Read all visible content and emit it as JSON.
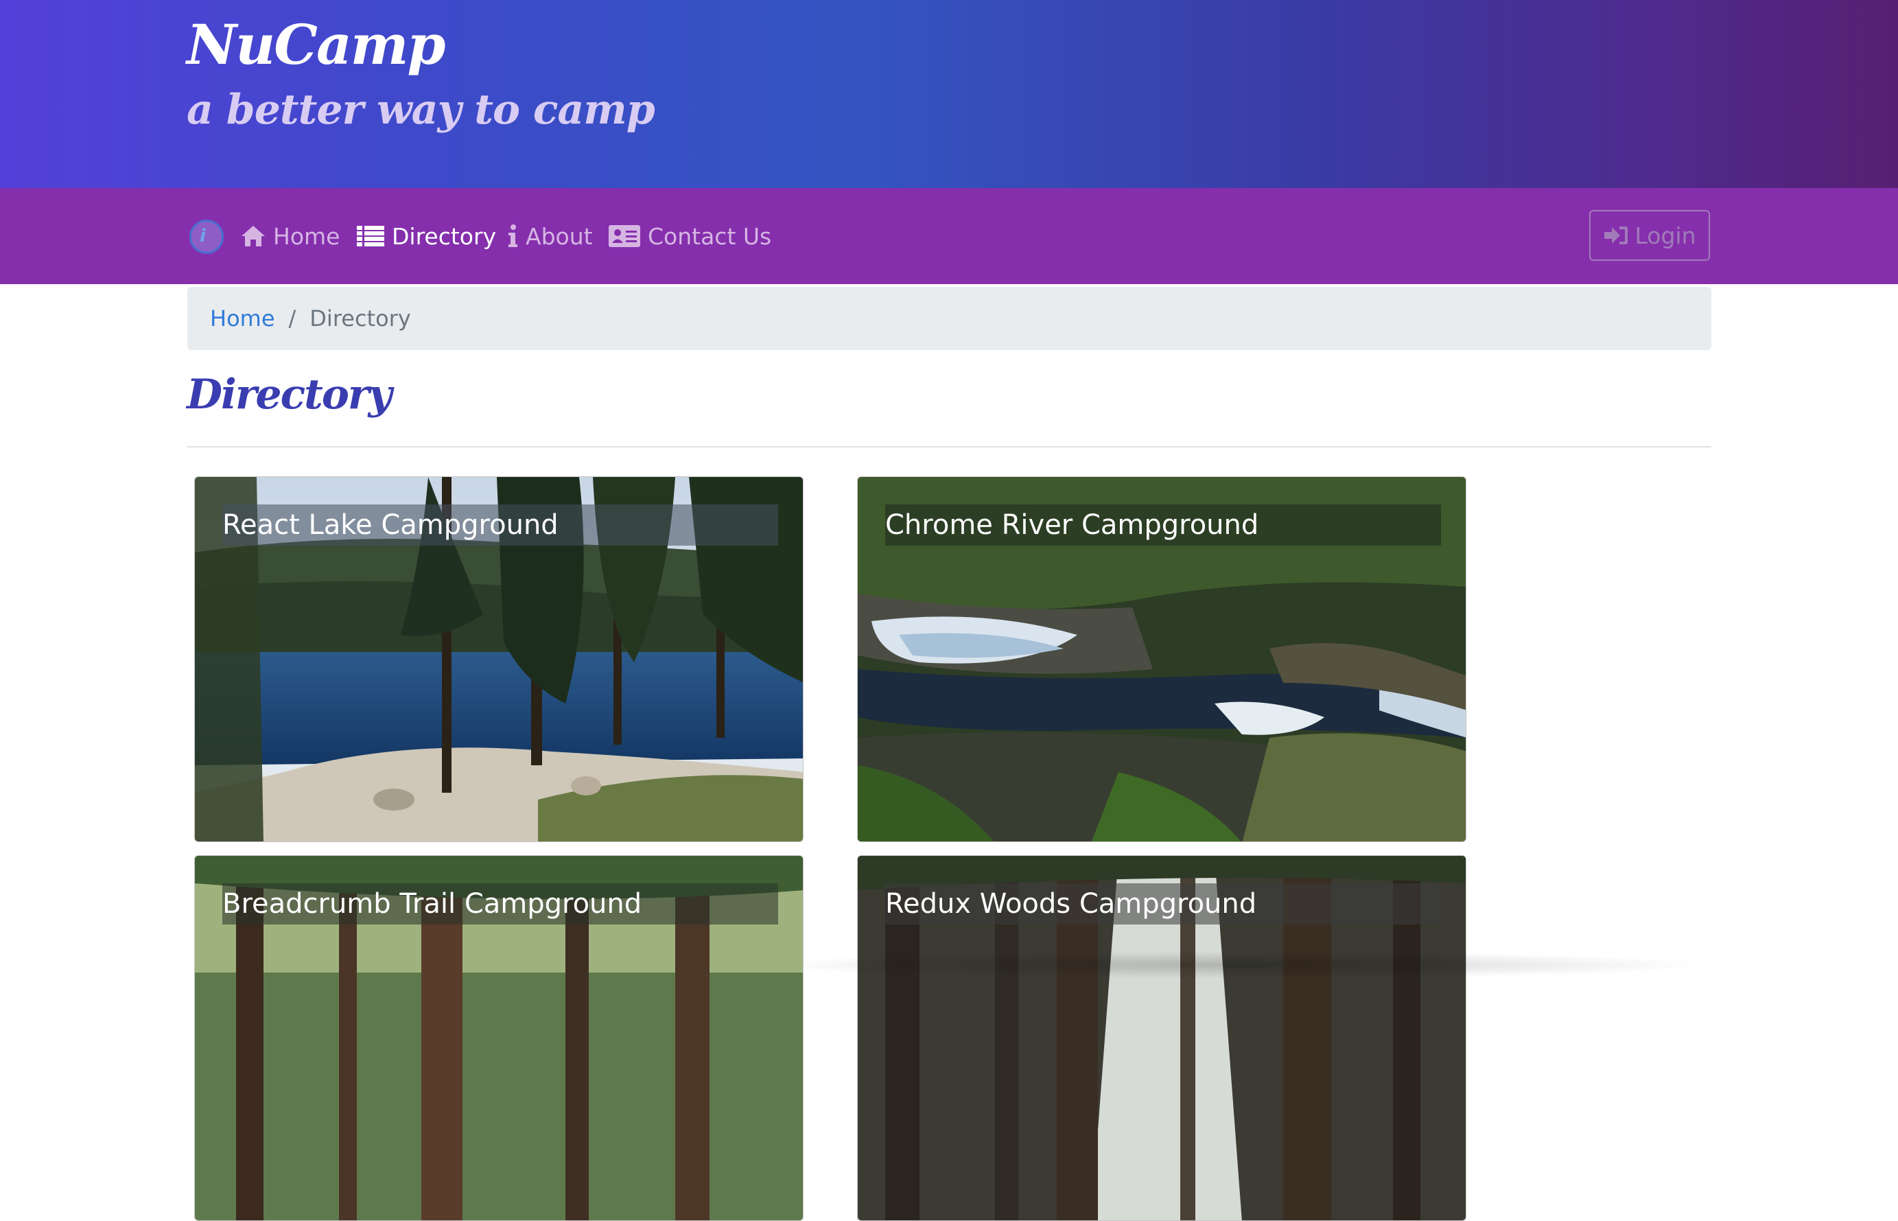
{
  "header": {
    "brand": "NuCamp",
    "tagline": "a better way to camp"
  },
  "nav": {
    "logo_icon": "nucamp-logo-icon",
    "items": [
      {
        "label": "Home",
        "icon": "home-icon",
        "active": false
      },
      {
        "label": "Directory",
        "icon": "list-icon",
        "active": true
      },
      {
        "label": "About",
        "icon": "info-icon",
        "active": false
      },
      {
        "label": "Contact Us",
        "icon": "address-card-icon",
        "active": false
      }
    ],
    "login_label": "Login",
    "login_icon": "sign-in-icon"
  },
  "breadcrumb": {
    "home": "Home",
    "separator": "/",
    "current": "Directory"
  },
  "page": {
    "heading": "Directory"
  },
  "campsites": [
    {
      "name": "React Lake Campground"
    },
    {
      "name": "Chrome River Campground"
    },
    {
      "name": "Breadcrumb Trail Campground"
    },
    {
      "name": "Redux Woods Campground"
    }
  ],
  "colors": {
    "navbar": "#852fad",
    "heading": "#3a3db0",
    "link": "#2f7bd9"
  }
}
